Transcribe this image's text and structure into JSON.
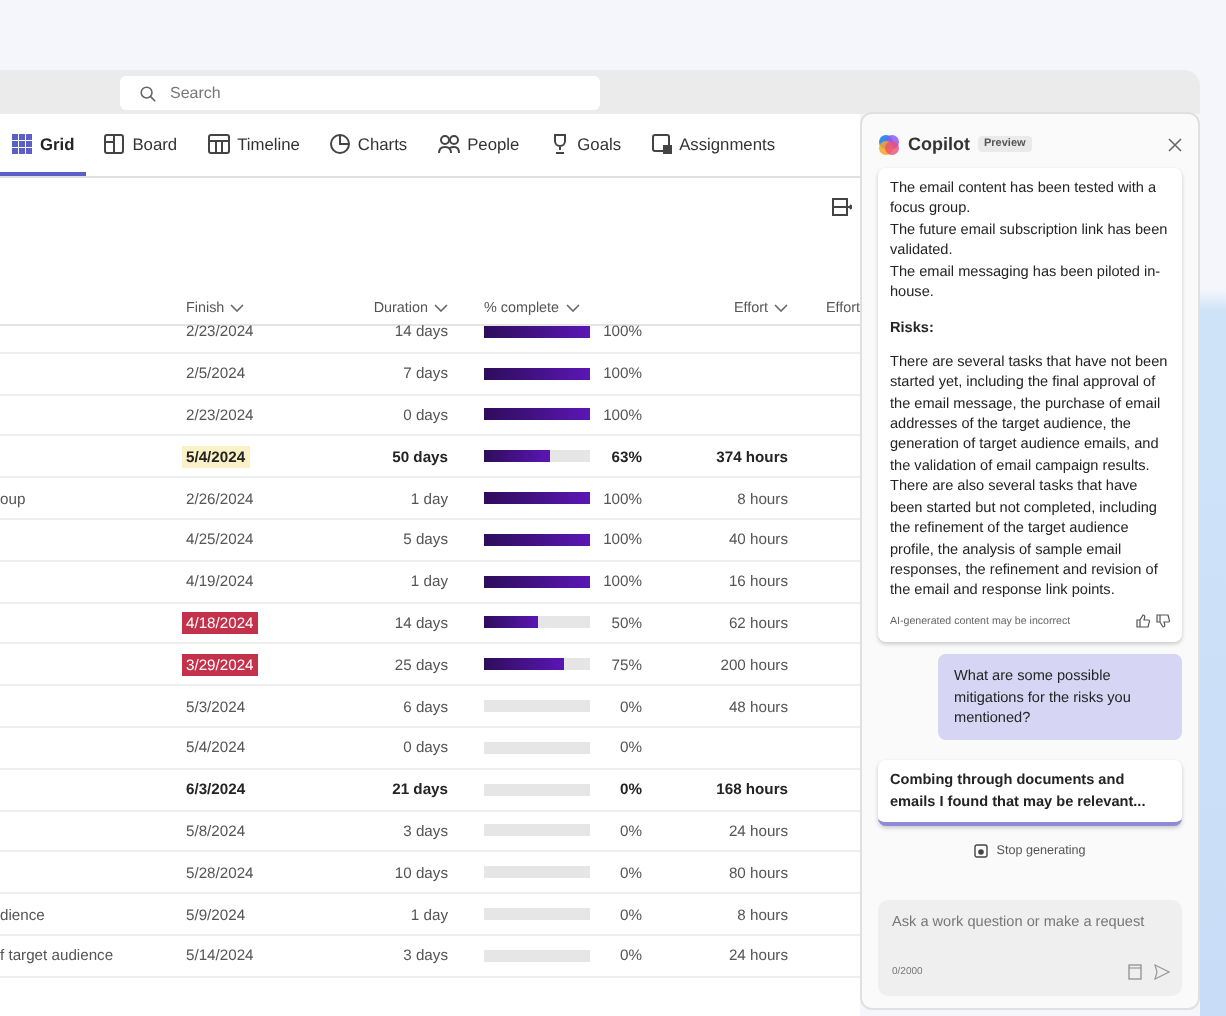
{
  "search": {
    "placeholder": "Search"
  },
  "tabs": [
    {
      "label": "Grid",
      "selected": true
    },
    {
      "label": "Board",
      "selected": false
    },
    {
      "label": "Timeline",
      "selected": false
    },
    {
      "label": "Charts",
      "selected": false
    },
    {
      "label": "People",
      "selected": false
    },
    {
      "label": "Goals",
      "selected": false
    },
    {
      "label": "Assignments",
      "selected": false
    }
  ],
  "table": {
    "columns": [
      "Finish",
      "Duration",
      "% complete",
      "Effort",
      "Effort"
    ],
    "rows": [
      {
        "task": "",
        "finish": "2/23/2024",
        "late": false,
        "at_risk": false,
        "duration": "14 days",
        "level": 1,
        "percent": "100%",
        "effort": "",
        "summary": false
      },
      {
        "task": "",
        "finish": "2/5/2024",
        "late": false,
        "at_risk": false,
        "duration": "7 days",
        "level": 1,
        "percent": "100%",
        "effort": "",
        "summary": false
      },
      {
        "task": "",
        "finish": "2/23/2024",
        "late": false,
        "at_risk": false,
        "duration": "0 days",
        "level": 1,
        "percent": "100%",
        "effort": "",
        "summary": false
      },
      {
        "task": "",
        "finish": "5/4/2024",
        "late": false,
        "at_risk": true,
        "duration": "50 days",
        "level": 0.63,
        "percent": "63%",
        "effort": "374 hours",
        "summary": true
      },
      {
        "task": "oup",
        "finish": "2/26/2024",
        "late": false,
        "at_risk": false,
        "duration": "1 day",
        "level": 1,
        "percent": "100%",
        "effort": "8 hours",
        "summary": false
      },
      {
        "task": "",
        "finish": "4/25/2024",
        "late": false,
        "at_risk": false,
        "duration": "5 days",
        "level": 1,
        "percent": "100%",
        "effort": "40 hours",
        "summary": false
      },
      {
        "task": "",
        "finish": "4/19/2024",
        "late": false,
        "at_risk": false,
        "duration": "1 day",
        "level": 1,
        "percent": "100%",
        "effort": "16 hours",
        "summary": false
      },
      {
        "task": "",
        "finish": "4/18/2024",
        "late": true,
        "at_risk": false,
        "duration": "14 days",
        "level": 0.5,
        "percent": "50%",
        "effort": "62 hours",
        "summary": false
      },
      {
        "task": "",
        "finish": "3/29/2024",
        "late": true,
        "at_risk": false,
        "duration": "25 days",
        "level": 0.75,
        "percent": "75%",
        "effort": "200 hours",
        "summary": false
      },
      {
        "task": "",
        "finish": "5/3/2024",
        "late": false,
        "at_risk": false,
        "duration": "6 days",
        "level": 0,
        "percent": "0%",
        "effort": "48 hours",
        "summary": false
      },
      {
        "task": "",
        "finish": "5/4/2024",
        "late": false,
        "at_risk": false,
        "duration": "0 days",
        "level": 0,
        "percent": "0%",
        "effort": "",
        "summary": false
      },
      {
        "task": "",
        "finish": "6/3/2024",
        "late": false,
        "at_risk": false,
        "duration": "21 days",
        "level": 0,
        "percent": "0%",
        "effort": "168 hours",
        "summary": true
      },
      {
        "task": "",
        "finish": "5/8/2024",
        "late": false,
        "at_risk": false,
        "duration": "3 days",
        "level": 0,
        "percent": "0%",
        "effort": "24 hours",
        "summary": false
      },
      {
        "task": "",
        "finish": "5/28/2024",
        "late": false,
        "at_risk": false,
        "duration": "10 days",
        "level": 0,
        "percent": "0%",
        "effort": "80 hours",
        "summary": false
      },
      {
        "task": "dience",
        "finish": "5/9/2024",
        "late": false,
        "at_risk": false,
        "duration": "1 day",
        "level": 0,
        "percent": "0%",
        "effort": "8 hours",
        "summary": false
      },
      {
        "task": "f target audience",
        "finish": "5/14/2024",
        "late": false,
        "at_risk": false,
        "duration": "3 days",
        "level": 0,
        "percent": "0%",
        "effort": "24 hours",
        "summary": false
      }
    ]
  },
  "copilot": {
    "title": "Copilot",
    "badge": "Preview",
    "answer": {
      "lines": [
        "The email content has been tested with a focus group.",
        "The future email subscription link has been validated.",
        "The email messaging has been piloted in-house."
      ],
      "heading": "Risks:",
      "paragraph": "There are several tasks that have not been started yet, including the final approval of the email message, the purchase of email addresses of the target audience, the generation of target audience emails, and the validation of email campaign results. There are also several tasks that have been started but not completed, including the refinement of the target audience profile, the analysis of sample email responses, the refinement and revision of the email and response link points.",
      "disclaimer": "AI-generated content may be incorrect"
    },
    "question": "What are some possible mitigations for the risks you mentioned?",
    "progress_message": "Combing through documents and emails I found that may be relevant...",
    "stop_button": "Stop generating",
    "input": {
      "placeholder": "Ask a work question or make a request",
      "counter": "0/2000"
    }
  }
}
